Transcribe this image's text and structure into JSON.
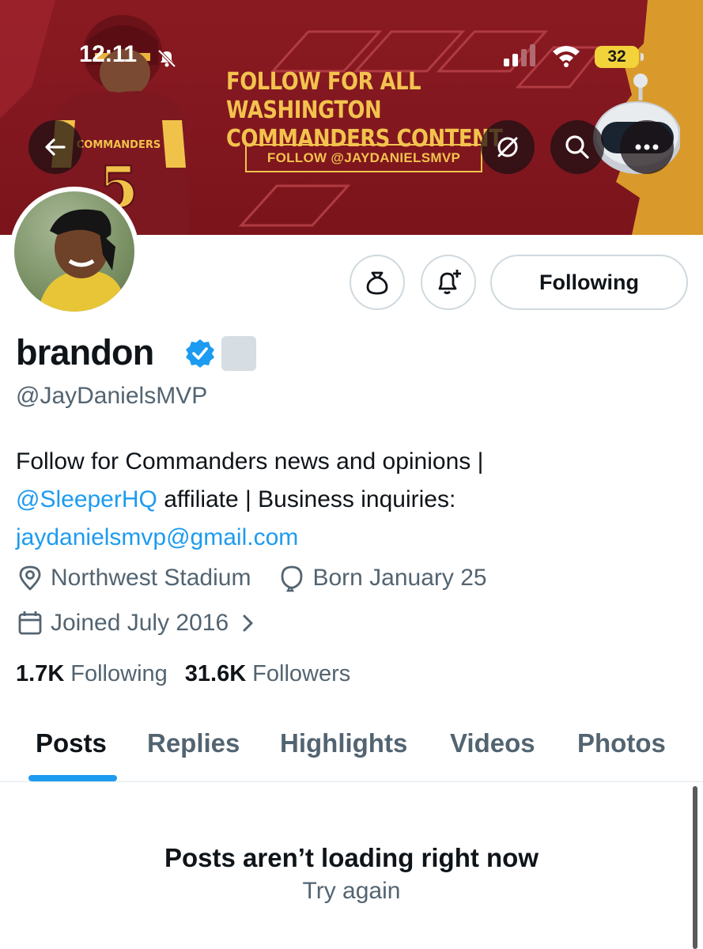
{
  "status_bar": {
    "time": "12:11",
    "battery": "32",
    "battery_color": "#f2d33a"
  },
  "banner": {
    "headline_line1": "FOLLOW FOR ALL WASHINGTON",
    "headline_line2": "COMMANDERS CONTENT",
    "cta": "FOLLOW @JAYDANIELSMVP",
    "jersey_text": "COMMANDERS",
    "jersey_number": "5",
    "background_color": "#7b141c",
    "accent_color": "#f3c34e"
  },
  "header_buttons": {
    "back_icon": "arrow-left-icon",
    "grok_icon": "grok-icon",
    "search_icon": "search-icon",
    "more_icon": "more-horizontal-icon"
  },
  "actions": {
    "grok_profile_icon": "grok-bag-icon",
    "notify_icon": "bell-plus-icon",
    "following_label": "Following"
  },
  "profile": {
    "display_name": "brandon",
    "handle": "@JayDanielsMVP",
    "bio_line1": "Follow for Commanders news and opinions |",
    "bio_mention": "@SleeperHQ",
    "bio_line2_rest": " affiliate | Business inquiries:",
    "bio_email": "jaydanielsmvp@gmail.com",
    "location": "Northwest Stadium",
    "birthday": "Born January 25",
    "joined": "Joined July 2016",
    "link_color": "#1d9bf0"
  },
  "stats": {
    "following_count": "1.7K",
    "following_label": "Following",
    "followers_count": "31.6K",
    "followers_label": "Followers"
  },
  "tabs": [
    {
      "label": "Posts",
      "active": true
    },
    {
      "label": "Replies",
      "active": false
    },
    {
      "label": "Highlights",
      "active": false
    },
    {
      "label": "Videos",
      "active": false
    },
    {
      "label": "Photos",
      "active": false
    }
  ],
  "empty_state": {
    "title": "Posts aren’t loading right now",
    "retry": "Try again"
  }
}
